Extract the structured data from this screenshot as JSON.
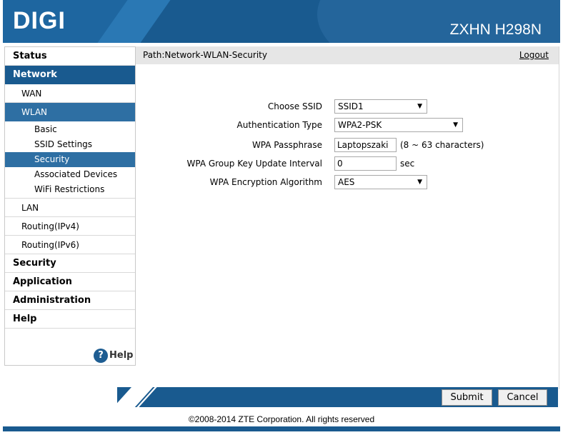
{
  "header": {
    "logo": "DIGI",
    "model": "ZXHN H298N"
  },
  "sidebar": {
    "items": [
      {
        "label": "Status",
        "level": 0,
        "active": false
      },
      {
        "label": "Network",
        "level": 0,
        "active": true
      },
      {
        "label": "WAN",
        "level": 1,
        "active": false
      },
      {
        "label": "WLAN",
        "level": 1,
        "active": true
      },
      {
        "label": "Basic",
        "level": 2,
        "active": false
      },
      {
        "label": "SSID Settings",
        "level": 2,
        "active": false
      },
      {
        "label": "Security",
        "level": 2,
        "active": true
      },
      {
        "label": "Associated Devices",
        "level": 2,
        "active": false
      },
      {
        "label": "WiFi Restrictions",
        "level": 2,
        "active": false
      },
      {
        "label": "LAN",
        "level": 1,
        "active": false
      },
      {
        "label": "Routing(IPv4)",
        "level": 1,
        "active": false
      },
      {
        "label": "Routing(IPv6)",
        "level": 1,
        "active": false
      },
      {
        "label": "Security",
        "level": 0,
        "active": false
      },
      {
        "label": "Application",
        "level": 0,
        "active": false
      },
      {
        "label": "Administration",
        "level": 0,
        "active": false
      },
      {
        "label": "Help",
        "level": 0,
        "active": false
      }
    ],
    "help_icon": "question-icon",
    "help_label": "Help"
  },
  "pathbar": {
    "path": "Path:Network-WLAN-Security",
    "logout": "Logout"
  },
  "form": {
    "ssid": {
      "label": "Choose SSID",
      "value": "SSID1"
    },
    "auth": {
      "label": "Authentication Type",
      "value": "WPA2-PSK"
    },
    "passphrase": {
      "label": "WPA Passphrase",
      "value": "Laptopszaki",
      "hint": "(8 ~ 63 characters)"
    },
    "group_key": {
      "label": "WPA Group Key Update Interval",
      "value": "0",
      "unit": "sec"
    },
    "encryption": {
      "label": "WPA Encryption Algorithm",
      "value": "AES"
    }
  },
  "footer": {
    "submit": "Submit",
    "cancel": "Cancel",
    "copyright": "©2008-2014 ZTE Corporation. All rights reserved"
  },
  "colors": {
    "brand": "#195a8f",
    "active_sub": "#2e6fa3"
  }
}
